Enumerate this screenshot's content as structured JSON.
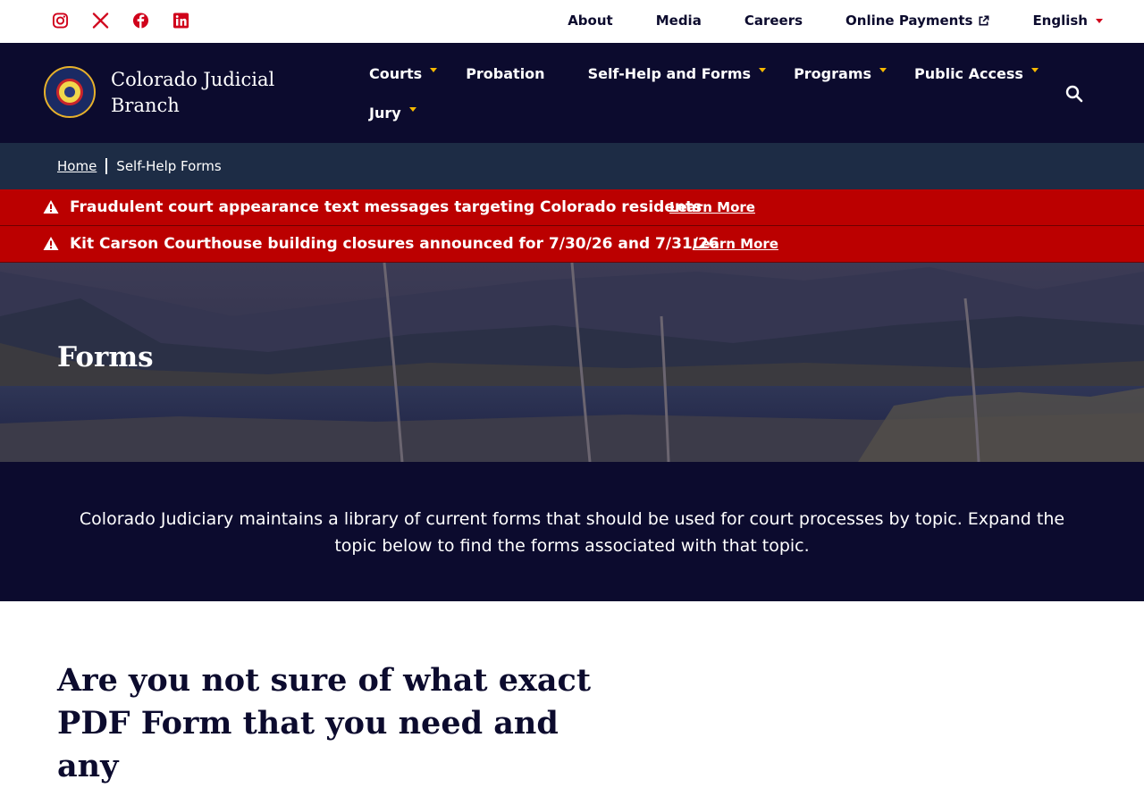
{
  "utility": {
    "social": [
      "instagram-icon",
      "x-icon",
      "facebook-icon",
      "linkedin-icon"
    ],
    "links": {
      "about": "About",
      "media": "Media",
      "careers": "Careers",
      "payments": "Online Payments",
      "language": "English"
    }
  },
  "brand": {
    "name": "Colorado Judicial Branch"
  },
  "nav": {
    "courts": "Courts",
    "probation": "Probation",
    "self_help": "Self-Help and Forms",
    "programs": "Programs",
    "public_access": "Public Access",
    "jury": "Jury"
  },
  "breadcrumb": {
    "home": "Home",
    "current": "Self-Help Forms"
  },
  "alerts": [
    {
      "text": "Fraudulent court appearance text messages targeting Colorado residents",
      "link": "Learn More"
    },
    {
      "text": "Kit Carson Courthouse building closures announced for 7/30/26 and 7/31/26",
      "link": "Learn More"
    }
  ],
  "hero": {
    "title": "Forms"
  },
  "intro": {
    "text": "Colorado Judiciary maintains a library of current forms that should be used for court processes by topic. Expand the topic below to find the forms associated with that topic."
  },
  "help": {
    "heading": "Are you not sure of what exact PDF Form that you need and any"
  },
  "colors": {
    "navy": "#0c0b2e",
    "breadcrumb_bg": "#1d2c45",
    "alert_red": "#bb0000",
    "accent_red": "#d0021b",
    "accent_gold": "#f5b800"
  }
}
